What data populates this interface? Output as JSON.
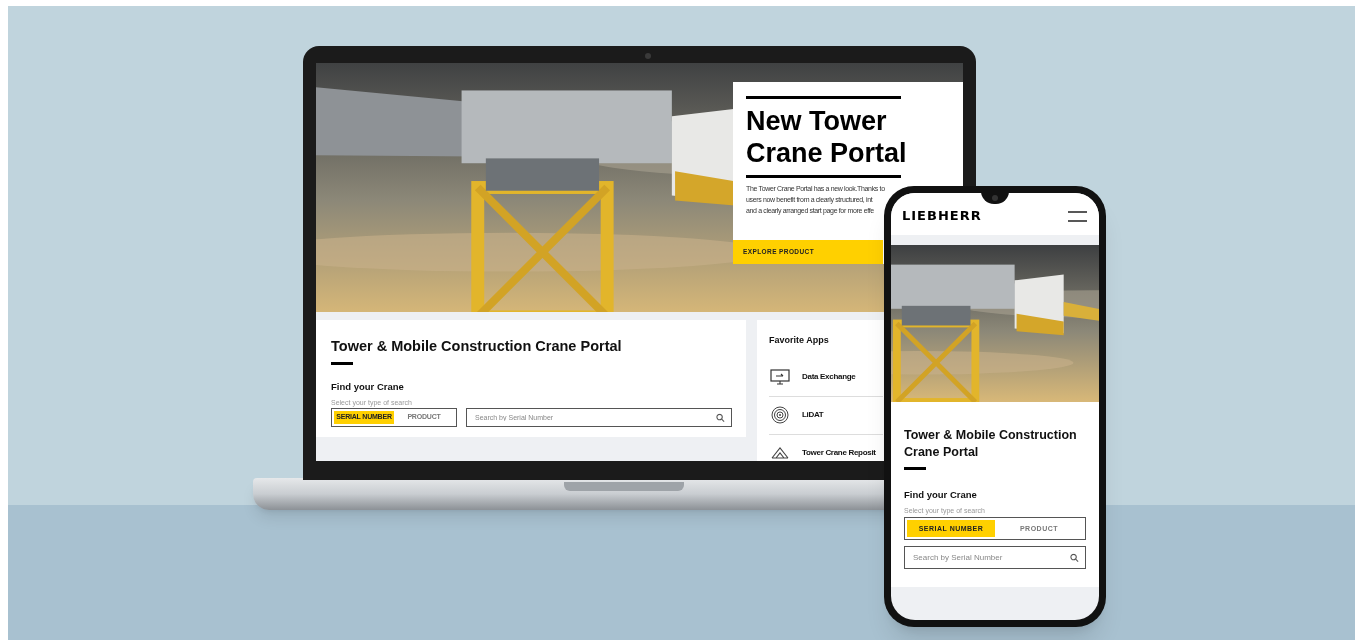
{
  "laptop": {
    "hero": {
      "kind": "picture",
      "card": {
        "title": "New Tower Crane Portal",
        "lines": [
          "The Tower Crane Portal has a new look.Thanks to",
          "users now benefit from a clearly structured, int",
          "and a clearly arranged start page for more effe"
        ],
        "button": "EXPLORE PRODUCT"
      }
    },
    "portal": {
      "title": "Tower & Mobile Construction Crane Portal",
      "find_label": "Find your Crane",
      "hint": "Select your type of search",
      "search_types": [
        {
          "label": "SERIAL NUMBER",
          "selected": true
        },
        {
          "label": "PRODUCT",
          "selected": false
        }
      ],
      "search": {
        "placeholder": "Search by Serial Number"
      }
    },
    "favorite_apps": {
      "title": "Favorite Apps",
      "items": [
        {
          "kind": "monitor",
          "label": "Data Exchange"
        },
        {
          "kind": "signal",
          "label": "LiDAT"
        },
        {
          "kind": "network",
          "label": "Tower Crane Reposit"
        }
      ]
    }
  },
  "phone": {
    "logo": "LIEBHERR",
    "portal": {
      "title": "Tower & Mobile Construction Crane Portal",
      "find_label": "Find your Crane",
      "hint": "Select your type of search",
      "search_types": [
        {
          "label": "SERIAL NUMBER",
          "selected": true
        },
        {
          "label": "PRODUCT",
          "selected": false
        }
      ],
      "search": {
        "placeholder": "Search by Serial Number"
      }
    }
  }
}
